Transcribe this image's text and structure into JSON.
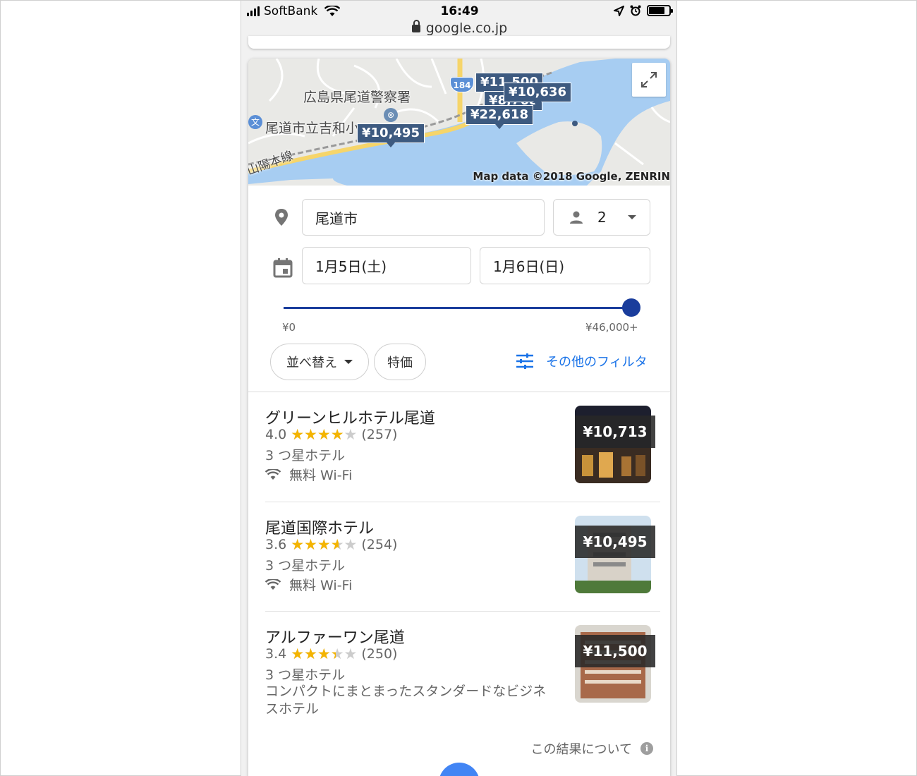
{
  "status_bar": {
    "carrier": "SoftBank",
    "time": "16:49"
  },
  "browser": {
    "url": "google.co.jp"
  },
  "map": {
    "labels": {
      "police": "広島県尾道警察署",
      "school": "尾道市立吉和小",
      "railway": "山陽本線",
      "route_number": "184"
    },
    "price_pins": [
      "¥10,495",
      "¥11,500",
      "¥8,768",
      "¥10,636",
      "¥22,618"
    ],
    "credit": "Map data ©2018 Google, ZENRIN",
    "colors": {
      "water": "#a7cdf2",
      "land": "#e9e9e6",
      "pin": "#3d5a80",
      "road": "#f6d56a"
    }
  },
  "search": {
    "location": "尾道市",
    "guests": "2",
    "checkin": "1月5日(土)",
    "checkout": "1月6日(日)",
    "price_min": "¥0",
    "price_max": "¥46,000+",
    "price_slider_value": 1.0
  },
  "filters": {
    "sort_label": "並べ替え",
    "deals_label": "特価",
    "more_filters_label": "その他のフィルタ"
  },
  "hotels": [
    {
      "name": "グリーンヒルホテル尾道",
      "rating": "4.0",
      "rating_value": 4.0,
      "reviews": "(257)",
      "class": "3 つ星ホテル",
      "amenity": "無料 Wi-Fi",
      "price": "¥10,713"
    },
    {
      "name": "尾道国際ホテル",
      "rating": "3.6",
      "rating_value": 3.6,
      "reviews": "(254)",
      "class": "3 つ星ホテル",
      "amenity": "無料 Wi-Fi",
      "price": "¥10,495"
    },
    {
      "name": "アルファーワン尾道",
      "rating": "3.4",
      "rating_value": 3.4,
      "reviews": "(250)",
      "class": "3 つ星ホテル",
      "description": "コンパクトにまとまったスタンダードなビジネスホテル",
      "price": "¥11,500"
    }
  ],
  "footer": {
    "about_results": "この結果について"
  },
  "colors": {
    "accent": "#1a73e8",
    "slider": "#1a3d9c",
    "star": "#f4b400"
  }
}
